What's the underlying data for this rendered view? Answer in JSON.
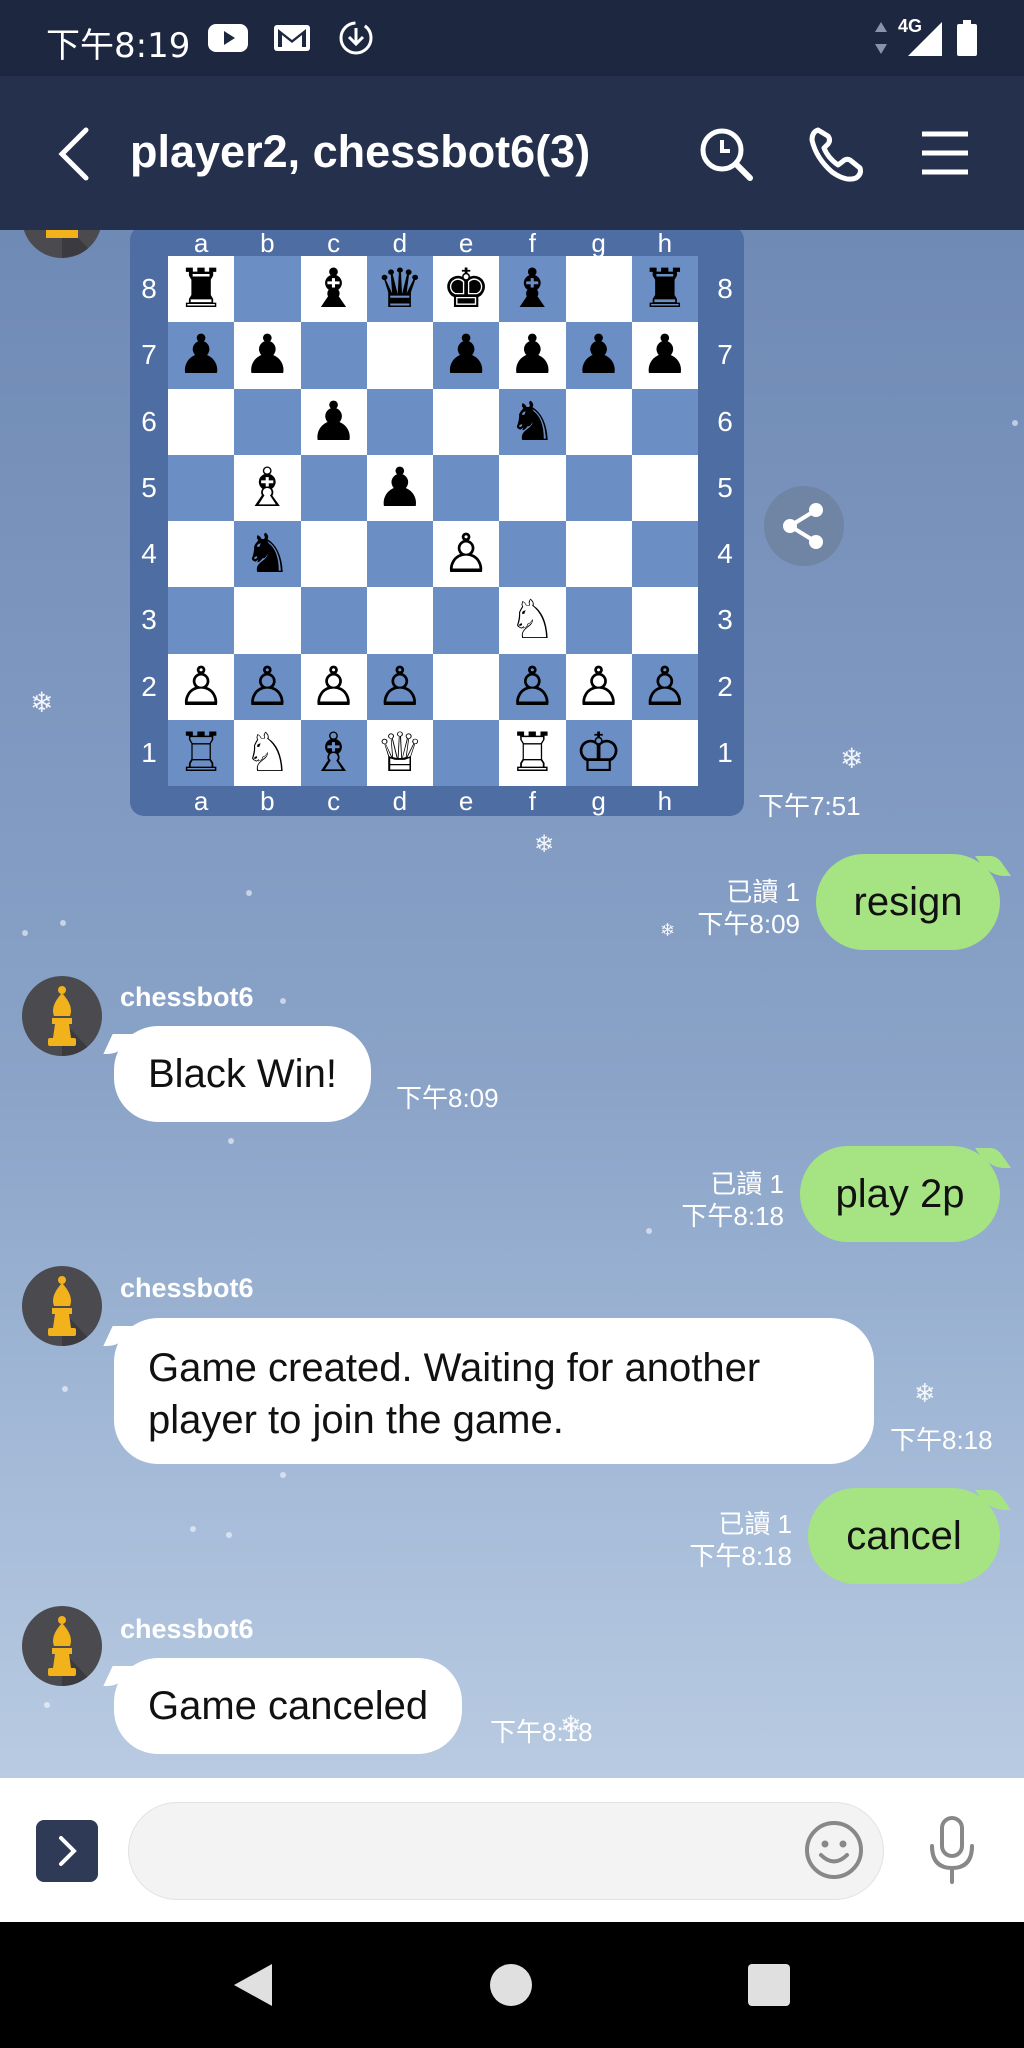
{
  "status_bar": {
    "time": "下午8:19",
    "icons": [
      "youtube-icon",
      "gmail-icon",
      "download-icon"
    ],
    "network": "4G"
  },
  "header": {
    "title": "player2, chessbot6(3)",
    "back_icon": "chevron-left-icon",
    "actions": [
      "search-icon",
      "phone-icon",
      "menu-icon"
    ]
  },
  "chess_board": {
    "files": [
      "a",
      "b",
      "c",
      "d",
      "e",
      "f",
      "g",
      "h"
    ],
    "ranks": [
      "8",
      "7",
      "6",
      "5",
      "4",
      "3",
      "2",
      "1"
    ],
    "position": [
      [
        "♜",
        "",
        "♝",
        "♛",
        "♚",
        "♝",
        "",
        "♜"
      ],
      [
        "♟",
        "♟",
        "",
        "",
        "♟",
        "♟",
        "♟",
        "♟"
      ],
      [
        "",
        "",
        "♟",
        "",
        "",
        "♞",
        "",
        ""
      ],
      [
        "",
        "♗",
        "",
        "♟",
        "",
        "",
        "",
        ""
      ],
      [
        "",
        "♞",
        "",
        "",
        "♙",
        "",
        "",
        ""
      ],
      [
        "",
        "",
        "",
        "",
        "",
        "♘",
        "",
        ""
      ],
      [
        "♙",
        "♙",
        "♙",
        "♙",
        "",
        "♙",
        "♙",
        "♙"
      ],
      [
        "♖",
        "♘",
        "♗",
        "♕",
        "",
        "♖",
        "♔",
        ""
      ]
    ],
    "timestamp": "下午7:51",
    "share_icon": "share-icon"
  },
  "messages": [
    {
      "type": "out",
      "text": "resign",
      "read": "已讀 1",
      "time": "下午8:09"
    },
    {
      "type": "in",
      "sender": "chessbot6",
      "text": "Black Win!",
      "time": "下午8:09"
    },
    {
      "type": "out",
      "text": "play 2p",
      "read": "已讀 1",
      "time": "下午8:18"
    },
    {
      "type": "in",
      "sender": "chessbot6",
      "text": "Game created. Waiting for another player to join the game.",
      "time": "下午8:18"
    },
    {
      "type": "out",
      "text": "cancel",
      "read": "已讀 1",
      "time": "下午8:18"
    },
    {
      "type": "in",
      "sender": "chessbot6",
      "text": "Game canceled",
      "time": "下午8:18"
    }
  ],
  "input_bar": {
    "placeholder": "",
    "icons": [
      "expand-icon",
      "emoji-icon",
      "microphone-icon"
    ]
  },
  "colors": {
    "header_bg": "#25304d",
    "status_bg": "#1d2740",
    "outgoing_bubble": "#a6e383",
    "incoming_bubble": "#ffffff",
    "board_dark": "#6b8ec4",
    "board_frame": "#4e6da3"
  }
}
